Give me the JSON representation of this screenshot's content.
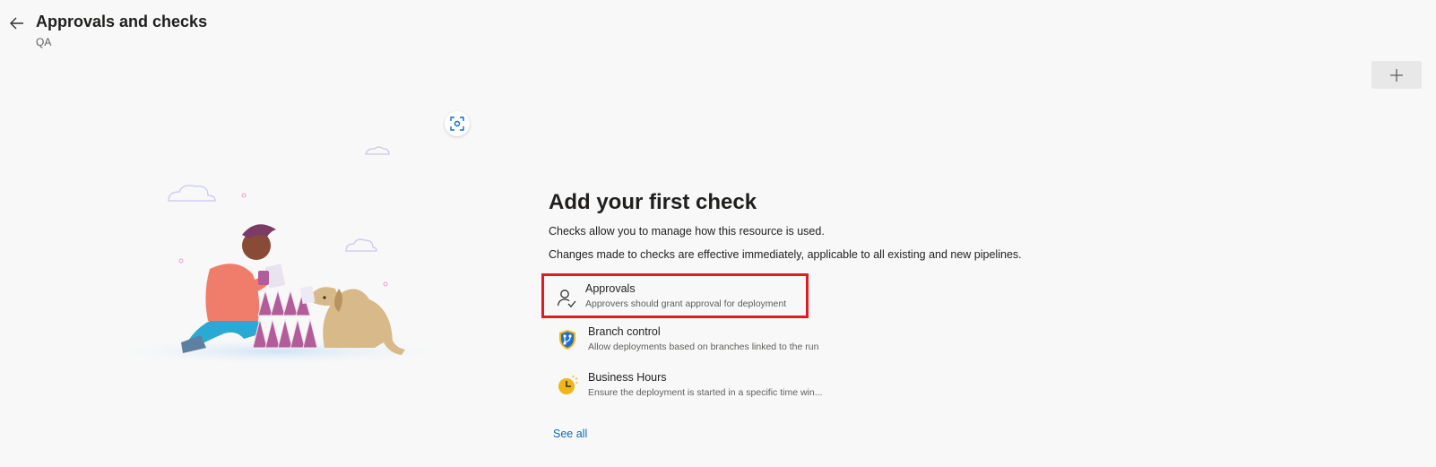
{
  "header": {
    "title": "Approvals and checks",
    "subtitle": "QA"
  },
  "empty_state": {
    "heading": "Add your first check",
    "description_1": "Checks allow you to manage how this resource is used.",
    "description_2": "Changes made to checks are effective immediately, applicable to all existing and new pipelines."
  },
  "checks": [
    {
      "name": "Approvals",
      "description": "Approvers should grant approval for deployment",
      "icon": "person-approve-icon"
    },
    {
      "name": "Branch control",
      "description": "Allow deployments based on branches linked to the run",
      "icon": "branch-shield-icon"
    },
    {
      "name": "Business Hours",
      "description": "Ensure the deployment is started in a specific time win...",
      "icon": "clock-icon"
    }
  ],
  "see_all_label": "See all",
  "colors": {
    "accent": "#0f6cbd",
    "highlight_border": "#e01b24",
    "background": "#f8f8f8"
  }
}
